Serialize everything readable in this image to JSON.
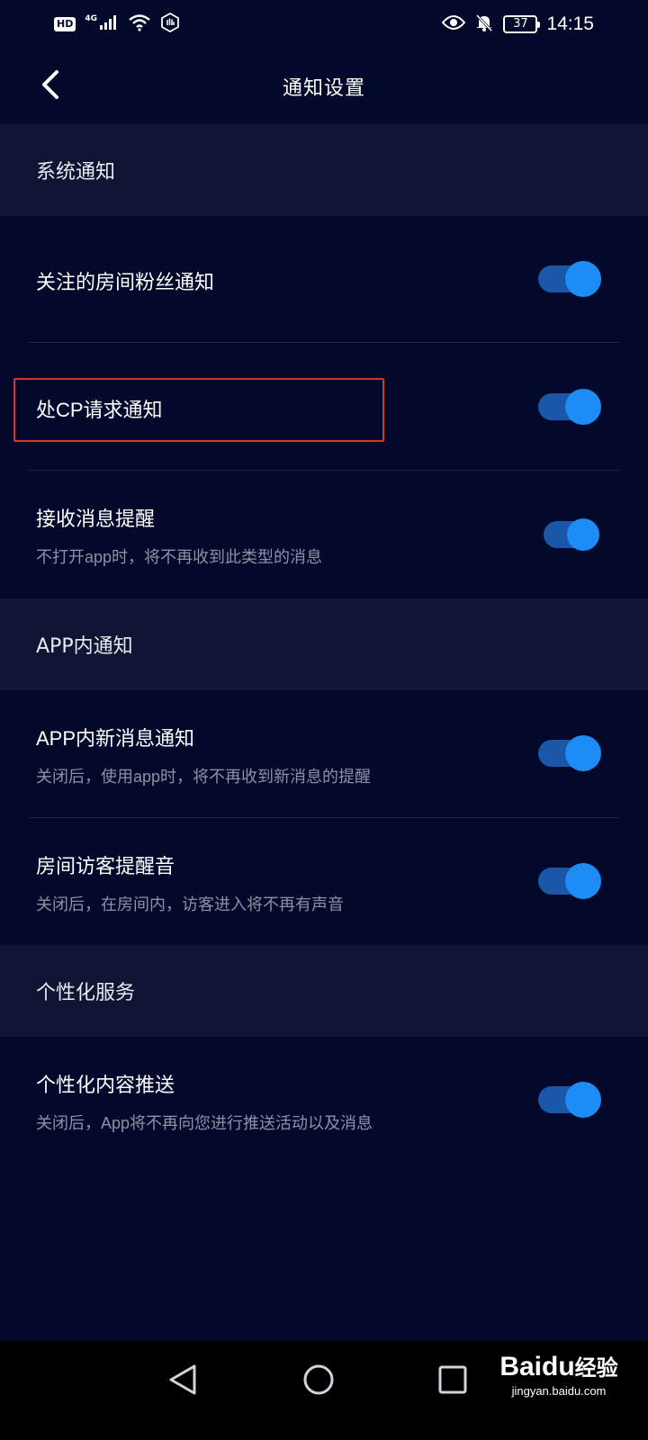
{
  "status_bar": {
    "hd": "HD",
    "network": "4G",
    "battery": "37",
    "time": "14:15",
    "icons": [
      "signal-icon",
      "wifi-icon",
      "hand-icon",
      "eye-icon",
      "bell-off-icon",
      "battery-icon"
    ]
  },
  "header": {
    "title": "通知设置",
    "back_icon": "chevron-left-icon"
  },
  "sections": {
    "system": {
      "header": "系统通知",
      "items": [
        {
          "title": "关注的房间粉丝通知",
          "enabled": true
        },
        {
          "title": "处CP请求通知",
          "enabled": true
        },
        {
          "title": "接收消息提醒",
          "desc": "不打开app时，将不再收到此类型的消息",
          "enabled": true
        }
      ]
    },
    "in_app": {
      "header": "APP内通知",
      "items": [
        {
          "title": "APP内新消息通知",
          "desc": "关闭后，使用app时，将不再收到新消息的提醒",
          "enabled": true
        },
        {
          "title": "房间访客提醒音",
          "desc": "关闭后，在房间内，访客进入将不再有声音",
          "enabled": true
        }
      ]
    },
    "personal": {
      "header": "个性化服务",
      "items": [
        {
          "title": "个性化内容推送",
          "desc": "关闭后，App将不再向您进行推送活动以及消息",
          "enabled": true
        }
      ]
    }
  },
  "system_nav": {
    "icons": [
      "back-triangle-icon",
      "home-circle-icon",
      "recents-square-icon"
    ]
  },
  "watermark": {
    "logo_bai": "Bai",
    "logo_du": "du",
    "logo_suffix": "经验",
    "url": "jingyan.baidu.com"
  },
  "colors": {
    "background": "#03092a",
    "section_header": "#0e1633",
    "toggle_track": "#1a57a8",
    "toggle_knob": "#1e8cf5",
    "highlight": "#d9342b"
  }
}
